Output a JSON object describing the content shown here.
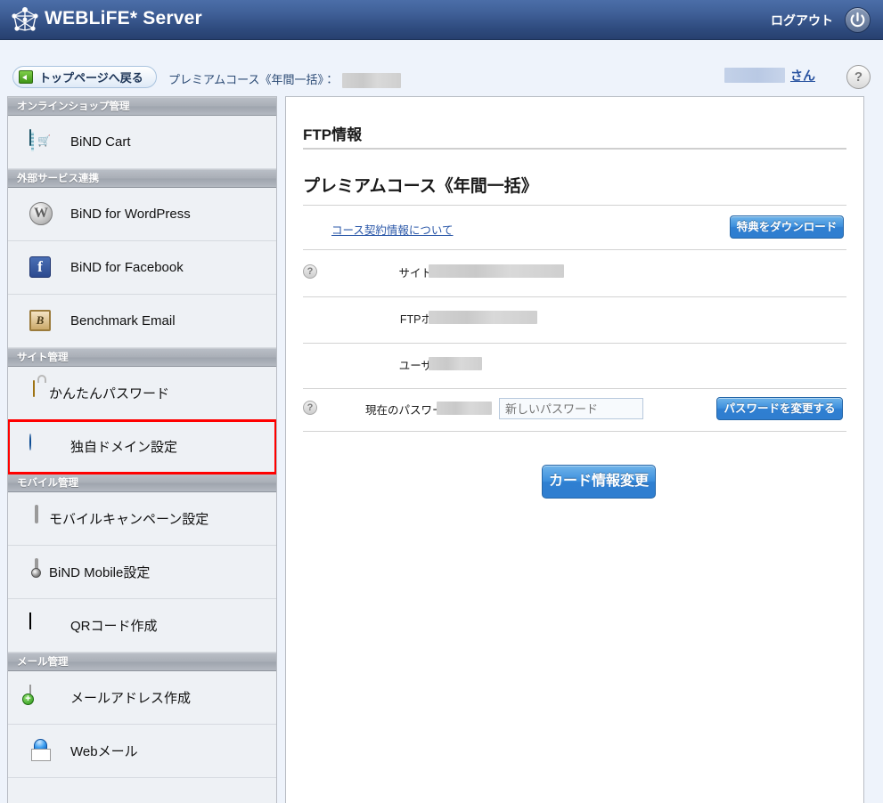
{
  "header": {
    "brand": "WEBLiFE* Server",
    "logo_icon": "network-nodes-logo-icon",
    "logout_label": "ログアウト",
    "power_icon": "power-icon"
  },
  "crumbbar": {
    "back_label": "トップページへ戻る",
    "back_icon": "back-arrow-icon",
    "course_text": "プレミアムコース《年間一括》：",
    "course_value_redacted": true,
    "user_name_redacted": true,
    "user_suffix": "さん",
    "help_label": "?"
  },
  "sidebar": {
    "sections": [
      {
        "title": "オンラインショップ管理",
        "items": [
          {
            "label": "BiND Cart",
            "icon": "cart-icon",
            "selected": false
          }
        ]
      },
      {
        "title": "外部サービス連携",
        "items": [
          {
            "label": "BiND for WordPress",
            "icon": "wordpress-icon",
            "selected": false
          },
          {
            "label": "BiND for Facebook",
            "icon": "facebook-icon",
            "selected": false
          },
          {
            "label": "Benchmark Email",
            "icon": "benchmark-email-icon",
            "selected": false
          }
        ]
      },
      {
        "title": "サイト管理",
        "items": [
          {
            "label": "かんたんパスワード",
            "icon": "lock-icon",
            "selected": false
          },
          {
            "label": "独自ドメイン設定",
            "icon": "globe-icon",
            "selected": true
          }
        ]
      },
      {
        "title": "モバイル管理",
        "items": [
          {
            "label": "モバイルキャンペーン設定",
            "icon": "mobile-phone-icon",
            "selected": false
          },
          {
            "label": "BiND Mobile設定",
            "icon": "mobile-settings-icon",
            "selected": false
          },
          {
            "label": "QRコード作成",
            "icon": "qr-code-icon",
            "selected": false
          }
        ]
      },
      {
        "title": "メール管理",
        "items": [
          {
            "label": "メールアドレス作成",
            "icon": "mail-add-icon",
            "selected": false
          },
          {
            "label": "Webメール",
            "icon": "webmail-icon",
            "selected": false
          }
        ]
      }
    ]
  },
  "main": {
    "title": "FTP情報",
    "course_title": "プレミアムコース《年間一括》",
    "contract_link": "コース契約情報について",
    "bonus_button": "特典をダウンロード",
    "rows": [
      {
        "help": true,
        "label": "サイトURL",
        "value_redacted": true,
        "redact_width": 152
      },
      {
        "help": false,
        "label": "FTPホスト",
        "value_redacted": true,
        "redact_width": 122
      },
      {
        "help": false,
        "label": "ユーザーID",
        "value_redacted": true,
        "redact_width": 60
      }
    ],
    "password_row": {
      "help": true,
      "label": "現在のパスワード",
      "current_redact_width": 62,
      "new_password_placeholder": "新しいパスワード",
      "new_password_value": "",
      "change_button": "パスワードを変更する"
    },
    "card_button": "カード情報変更"
  },
  "colors": {
    "header_blue": "#2e4a7d",
    "accent_blue": "#2f7fd0",
    "highlight_red": "#ff0000",
    "panel_bg": "#ffffff",
    "page_bg": "#eef3fb",
    "sidebar_bg": "#eef1f5",
    "section_header_gray": "#a9aeb6"
  }
}
